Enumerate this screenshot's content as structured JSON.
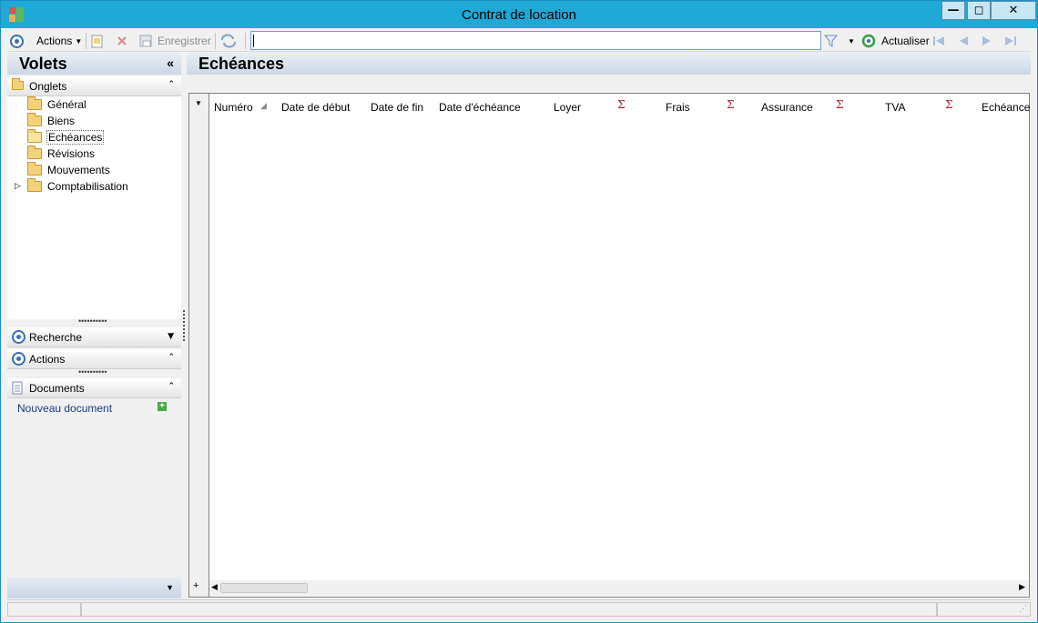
{
  "window": {
    "title": "Contrat de location"
  },
  "toolbar": {
    "actions_label": "Actions",
    "save_label": "Enregistrer",
    "search_value": "",
    "refresh_label": "Actualiser"
  },
  "left_panel": {
    "title": "Volets",
    "tabs_section": {
      "label": "Onglets",
      "items": [
        {
          "label": "Général"
        },
        {
          "label": "Biens"
        },
        {
          "label": "Echéances",
          "selected": true
        },
        {
          "label": "Révisions"
        },
        {
          "label": "Mouvements"
        },
        {
          "label": "Comptabilisation",
          "expandable": true
        }
      ]
    },
    "search_section": {
      "label": "Recherche"
    },
    "actions_section": {
      "label": "Actions"
    },
    "documents_section": {
      "label": "Documents",
      "new_document": "Nouveau document"
    }
  },
  "main": {
    "title": "Echéances",
    "columns": [
      {
        "label": "Numéro"
      },
      {
        "label": "Date de début"
      },
      {
        "label": "Date de fin"
      },
      {
        "label": "Date d'échéance"
      },
      {
        "label": "Loyer"
      },
      {
        "label": "Frais"
      },
      {
        "label": "Assurance"
      },
      {
        "label": "TVA"
      },
      {
        "label": "Echéance"
      }
    ],
    "sigma": "Σ",
    "rows": []
  },
  "colors": {
    "titlebar": "#1fa9d6",
    "accent": "#3b6fb0",
    "sigma": "#b5162b"
  }
}
